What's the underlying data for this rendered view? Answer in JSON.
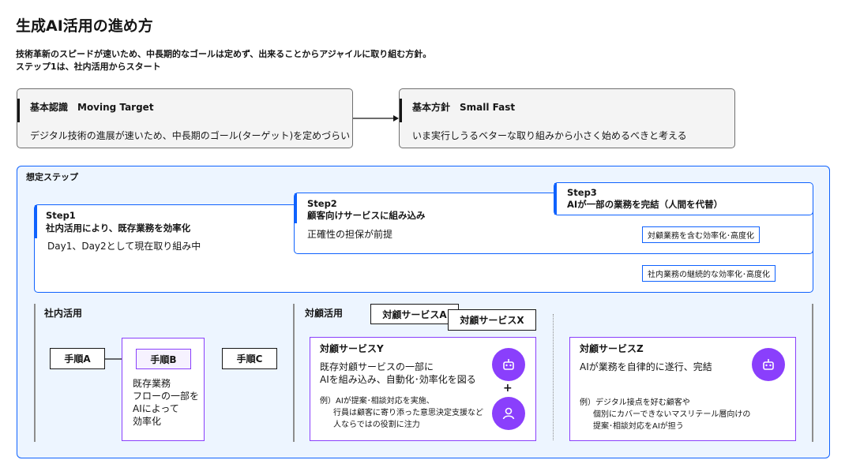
{
  "title": "生成AI活用の進め方",
  "subtitle_lines": [
    "技術革新のスピードが速いため、中長期的なゴールは定めず、出来ることからアジャイルに取り組む方針。",
    "ステップ1は、社内活用からスタート"
  ],
  "basic_recognition": {
    "heading": "基本認識　Moving Target",
    "body": "デジタル技術の進展が速いため、中長期のゴール(ターゲット)を定めづらい"
  },
  "basic_policy": {
    "heading": "基本方針　Small Fast",
    "body": "いま実行しうるベターな取り組みから小さく始めるべきと考える"
  },
  "steps_section": {
    "label": "想定ステップ",
    "step1": {
      "name": "Step1",
      "title": "社内活用により、既存業務を効率化",
      "desc": "Day1、Day2として現在取り組み中"
    },
    "step2": {
      "name": "Step2",
      "title": "顧客向けサービスに組み込み",
      "desc": "正確性の担保が前提"
    },
    "step3": {
      "name": "Step3",
      "title": "AIが一部の業務を完結（人間を代替）"
    },
    "tag_customer": "対顧業務を含む効率化･高度化",
    "tag_internal": "社内業務の継続的な効率化･高度化"
  },
  "internal": {
    "label": "社内活用",
    "procA": "手順A",
    "procB": "手順B",
    "procC": "手順C",
    "procB_desc": [
      "既存業務",
      "フローの一部を",
      "AIによって",
      "効率化"
    ]
  },
  "customer": {
    "label": "対顧活用",
    "serviceA": "対顧サービスA",
    "serviceX": "対顧サービスX",
    "serviceY": {
      "title": "対顧サービスY",
      "body": [
        "既存対顧サービスの一部に",
        "AIを組み込み、自動化･効率化を図る"
      ],
      "plus": "+",
      "example": [
        "例）AIが提案･相談対応を実施、",
        "行員は顧客に寄り添った意思決定支援など",
        "人ならではの役割に注力"
      ]
    },
    "serviceZ": {
      "title": "対顧サービスZ",
      "body": "AIが業務を自律的に遂行、完結",
      "example": [
        "例）デジタル接点を好む顧客や",
        "個別にカバーできないマスリテール層向けの",
        "提案･相談対応をAIが担う"
      ]
    }
  },
  "colors": {
    "accent_blue": "#0f62fe",
    "accent_purple": "#8a3ffc",
    "panel_bg": "#edf5ff"
  },
  "icons": [
    "robot-icon",
    "person-icon"
  ]
}
